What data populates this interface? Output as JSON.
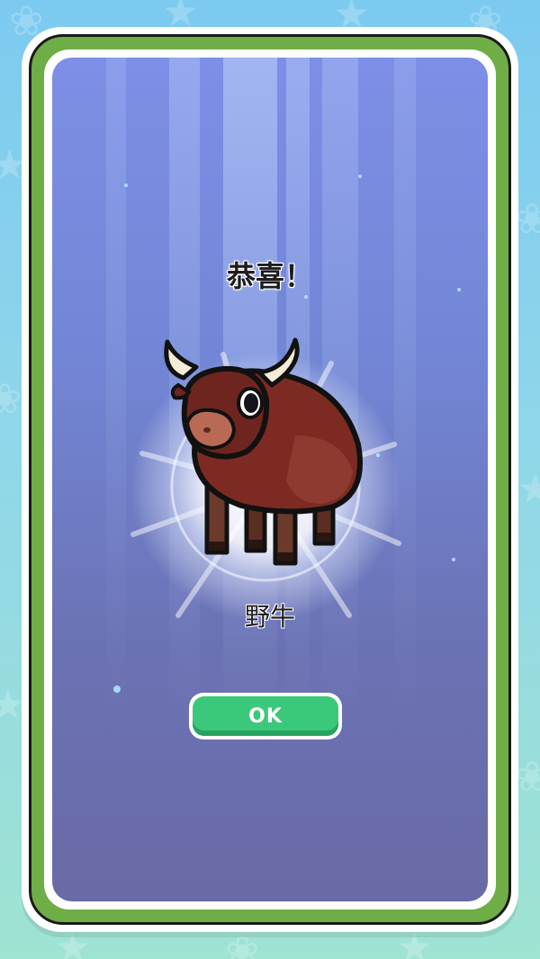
{
  "dialog": {
    "title": "恭喜！",
    "animal_name": "野牛",
    "animal_icon": "bison-icon",
    "ok_label": "OK"
  },
  "colors": {
    "frame_green": "#6fae46",
    "panel_top": "#7d8fe6",
    "panel_bottom": "#6a6aa6",
    "button_green": "#3cc87a",
    "text": "#1e1e1e"
  }
}
